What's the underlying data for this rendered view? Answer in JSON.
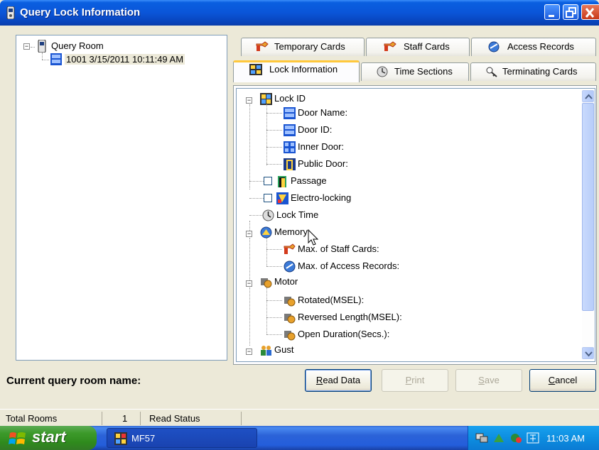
{
  "window": {
    "title": "Query Lock Information"
  },
  "left_tree": {
    "root_label": "Query Room",
    "child_label": "1001 3/15/2011 10:11:49 AM"
  },
  "tabs": {
    "row_back": [
      "Temporary Cards",
      "Staff Cards",
      "Access Records"
    ],
    "row_front": [
      "Lock Information",
      "Time Sections",
      "Terminating Cards"
    ],
    "active": "Lock Information"
  },
  "lock_tree": {
    "lock_id": "Lock ID",
    "door_name": "Door Name:",
    "door_id": "Door ID:",
    "inner_door": "Inner Door:",
    "public_door": "Public Door:",
    "passage": "Passage",
    "electro_locking": "Electro-locking",
    "lock_time": "Lock Time",
    "memory": "Memory",
    "max_staff_cards": "Max. of Staff Cards:",
    "max_access_records": "Max. of Access Records:",
    "motor": "Motor",
    "rotated": "Rotated(MSEL):",
    "reversed_length": "Reversed Length(MSEL):",
    "open_duration": "Open Duration(Secs.):",
    "gust": "Gust"
  },
  "footer": {
    "room_name_label": "Current query room name:",
    "buttons": {
      "read_data": {
        "accel": "R",
        "rest": "ead Data"
      },
      "print": {
        "accel": "P",
        "rest": "rint"
      },
      "save": {
        "accel": "S",
        "rest": "ave"
      },
      "cancel": {
        "accel": "C",
        "rest": "ancel"
      }
    }
  },
  "statusbar": {
    "total_rooms_label": "Total Rooms",
    "total_rooms_value": "1",
    "read_status_label": "Read Status"
  },
  "taskbar": {
    "start_label": "start",
    "task_label": "MF57",
    "clock": "11:03 AM"
  },
  "icons": [
    "app-icon",
    "minimize-icon",
    "maximize-icon",
    "close-icon",
    "room-icon",
    "key-icon",
    "access-record-icon",
    "clock-icon",
    "terminate-card-icon",
    "door-icon",
    "gear-icon",
    "people-icon",
    "cursor-icon",
    "windows-logo-icon"
  ]
}
